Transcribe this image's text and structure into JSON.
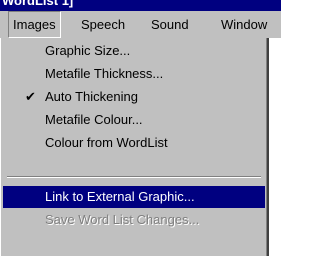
{
  "window": {
    "title": "WordList 1]"
  },
  "menubar": [
    {
      "label": "Images"
    },
    {
      "label": "Speech"
    },
    {
      "label": "Sound"
    },
    {
      "label": "Window"
    }
  ],
  "images_menu": {
    "items": [
      {
        "label": "Graphic Size...",
        "checked": false,
        "enabled": true
      },
      {
        "label": "Metafile Thickness...",
        "checked": false,
        "enabled": true
      },
      {
        "label": "Auto Thickening",
        "checked": true,
        "enabled": true
      },
      {
        "label": "Metafile Colour...",
        "checked": false,
        "enabled": true
      },
      {
        "label": "Colour from WordList",
        "checked": false,
        "enabled": true
      },
      {
        "label": "Link to External Graphic...",
        "checked": false,
        "enabled": true,
        "highlighted": true
      },
      {
        "label": "Save Word List Changes...",
        "checked": false,
        "enabled": false
      }
    ],
    "check_glyph": "✔"
  },
  "colors": {
    "menu_bg": "#c0c0c0",
    "highlight": "#000080",
    "disabled_text": "#808080"
  }
}
